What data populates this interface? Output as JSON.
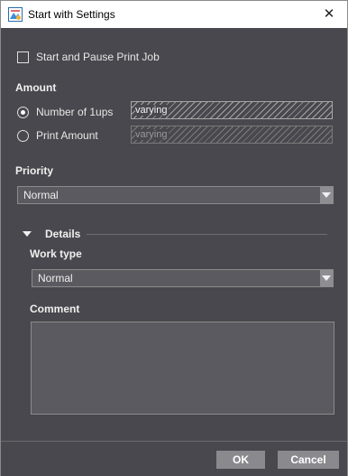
{
  "window": {
    "title": "Start with Settings",
    "close_glyph": "✕"
  },
  "options": {
    "start_pause_label": "Start and Pause Print Job",
    "start_pause_checked": false
  },
  "amount": {
    "heading": "Amount",
    "number_of_1ups_label": "Number of 1ups",
    "number_of_1ups_value": "varying",
    "print_amount_label": "Print Amount",
    "print_amount_value": "varying",
    "selected": "number_of_1ups"
  },
  "priority": {
    "heading": "Priority",
    "selected": "Normal"
  },
  "details": {
    "heading": "Details",
    "expanded": true,
    "work_type_heading": "Work type",
    "work_type_selected": "Normal",
    "comment_heading": "Comment",
    "comment_value": ""
  },
  "footer": {
    "ok_label": "OK",
    "cancel_label": "Cancel"
  },
  "icons": {
    "app": "app-icon",
    "close": "close-icon",
    "dropdown": "chevron-down-icon",
    "details_toggle": "triangle-down-icon"
  },
  "colors": {
    "background": "#48484e",
    "field": "#5a5a60",
    "button": "#8a8a8e"
  }
}
